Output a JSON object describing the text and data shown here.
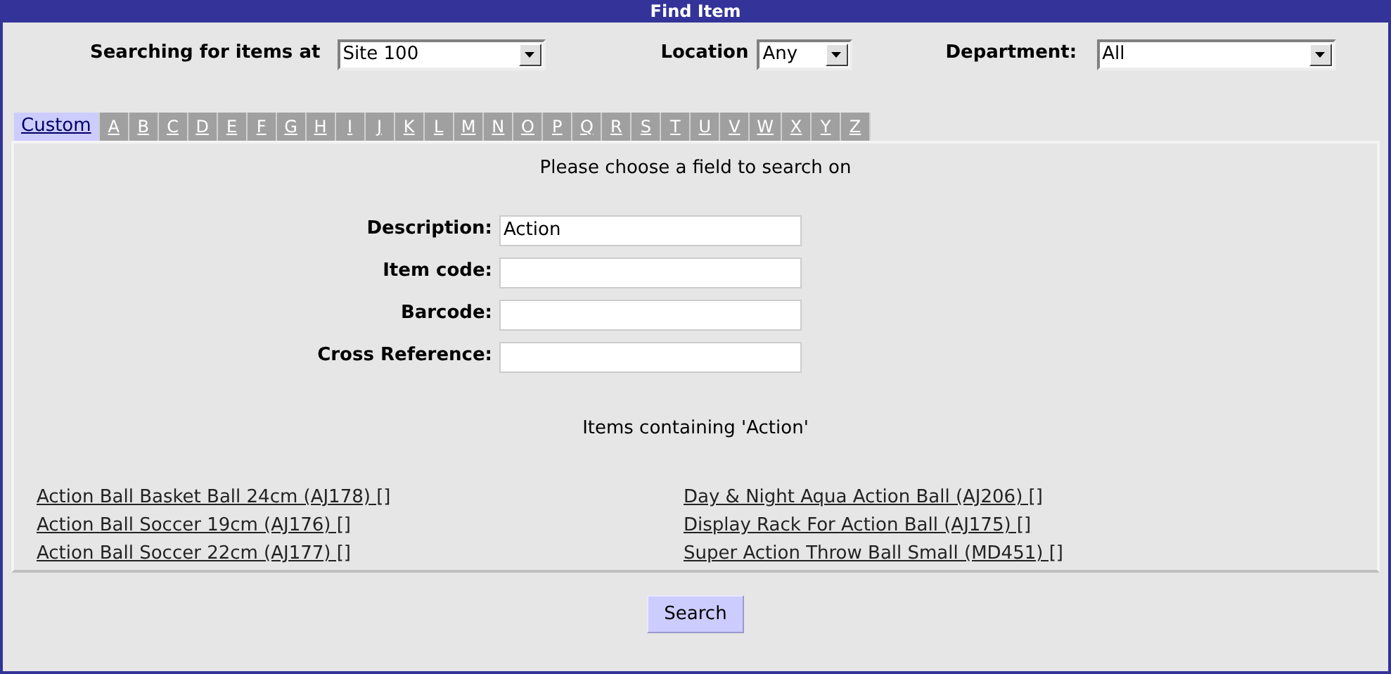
{
  "window": {
    "title": "Find Item"
  },
  "filters": [
    {
      "label": "Searching for items at",
      "value": "Site 100"
    },
    {
      "label": "Location",
      "value": "Any"
    },
    {
      "label": "Department:",
      "value": "All"
    }
  ],
  "tabs": [
    {
      "label": "Custom",
      "selected": true
    },
    {
      "label": "A",
      "selected": false
    },
    {
      "label": "B",
      "selected": false
    },
    {
      "label": "C",
      "selected": false
    },
    {
      "label": "D",
      "selected": false
    },
    {
      "label": "E",
      "selected": false
    },
    {
      "label": "F",
      "selected": false
    },
    {
      "label": "G",
      "selected": false
    },
    {
      "label": "H",
      "selected": false
    },
    {
      "label": "I",
      "selected": false
    },
    {
      "label": "J",
      "selected": false
    },
    {
      "label": "K",
      "selected": false
    },
    {
      "label": "L",
      "selected": false
    },
    {
      "label": "M",
      "selected": false
    },
    {
      "label": "N",
      "selected": false
    },
    {
      "label": "O",
      "selected": false
    },
    {
      "label": "P",
      "selected": false
    },
    {
      "label": "Q",
      "selected": false
    },
    {
      "label": "R",
      "selected": false
    },
    {
      "label": "S",
      "selected": false
    },
    {
      "label": "T",
      "selected": false
    },
    {
      "label": "U",
      "selected": false
    },
    {
      "label": "V",
      "selected": false
    },
    {
      "label": "W",
      "selected": false
    },
    {
      "label": "X",
      "selected": false
    },
    {
      "label": "Y",
      "selected": false
    },
    {
      "label": "Z",
      "selected": false
    }
  ],
  "prompt": "Please choose a field to search on",
  "fields": [
    {
      "label": "Description:",
      "value": "Action"
    },
    {
      "label": "Item code:"
    },
    {
      "label": "Barcode:"
    },
    {
      "label": "Cross Reference:"
    }
  ],
  "results_heading": "Items containing 'Action'",
  "results": [
    [
      "Action Ball Basket Ball 24cm (AJ178) []",
      "Action Ball Soccer 19cm (AJ176) []",
      "Action Ball Soccer 22cm (AJ177) []"
    ],
    [
      "Day & Night Aqua Action Ball (AJ206) []",
      "Display Rack For Action Ball (AJ175) []",
      "Super Action Throw Ball Small (MD451) []"
    ]
  ],
  "search_button": "Search"
}
